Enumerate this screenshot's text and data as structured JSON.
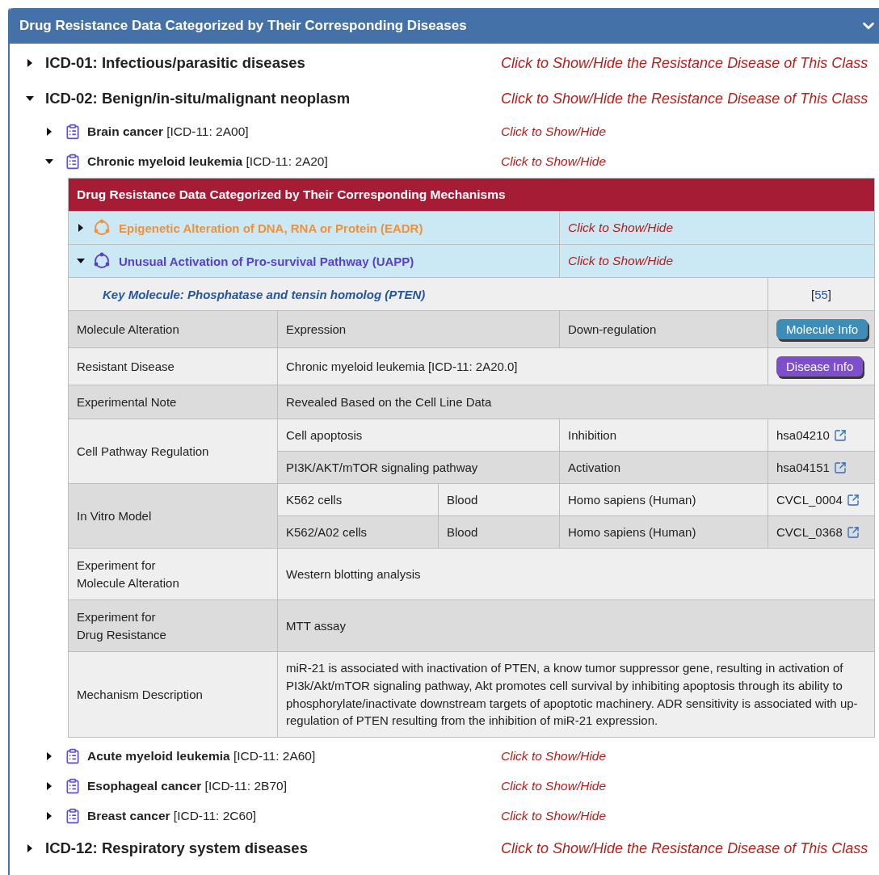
{
  "panel": {
    "title": "Drug Resistance Data Categorized by Their Corresponding Diseases",
    "expanded": true
  },
  "classes": [
    {
      "label": "ICD-01: Infectious/parasitic diseases",
      "toggle": "Click to Show/Hide the Resistance Disease of This Class",
      "expanded": false
    },
    {
      "label": "ICD-02: Benign/in-situ/malignant neoplasm",
      "toggle": "Click to Show/Hide the Resistance Disease of This Class",
      "expanded": true,
      "diseases": [
        {
          "name": "Brain cancer",
          "code": "[ICD-11: 2A00]",
          "toggle": "Click to Show/Hide",
          "expanded": false
        },
        {
          "name": "Chronic myeloid leukemia",
          "code": "[ICD-11: 2A20]",
          "toggle": "Click to Show/Hide",
          "expanded": true,
          "mechanisms": {
            "title": "Drug Resistance Data Categorized by Their Corresponding Mechanisms",
            "items": [
              {
                "name": "Epigenetic Alteration of DNA, RNA or Protein (EADR)",
                "toggle": "Click to Show/Hide",
                "expanded": false,
                "color": "#f0913a"
              },
              {
                "name": "Unusual Activation of Pro-survival Pathway (UAPP)",
                "toggle": "Click to Show/Hide",
                "expanded": true,
                "color": "#5b3fc8",
                "details": {
                  "key_molecule": "Key Molecule: Phosphatase and tensin homolog (PTEN)",
                  "reference": {
                    "before": "[",
                    "link": "55",
                    "after": "]"
                  },
                  "rows": [
                    {
                      "kind": "alteration",
                      "label": "Molecule Alteration",
                      "value": "Expression",
                      "direction": "Down-regulation",
                      "button": "Molecule Info"
                    },
                    {
                      "kind": "disease",
                      "label": "Resistant Disease",
                      "value": "Chronic myeloid leukemia [ICD-11: 2A20.0]",
                      "button": "Disease Info"
                    },
                    {
                      "kind": "text",
                      "label": "Experimental Note",
                      "value": "Revealed Based on the Cell Line Data"
                    },
                    {
                      "kind": "pathway",
                      "label": "Cell Pathway Regulation",
                      "entries": [
                        {
                          "pathway": "Cell apoptosis",
                          "effect": "Inhibition",
                          "id": "hsa04210"
                        },
                        {
                          "pathway": "PI3K/AKT/mTOR signaling pathway",
                          "effect": "Activation",
                          "id": "hsa04151"
                        }
                      ]
                    },
                    {
                      "kind": "model",
                      "label": "In Vitro Model",
                      "entries": [
                        {
                          "cell": "K562 cells",
                          "tissue": "Blood",
                          "species": "Homo sapiens (Human)",
                          "id": "CVCL_0004"
                        },
                        {
                          "cell": "K562/A02 cells",
                          "tissue": "Blood",
                          "species": "Homo sapiens (Human)",
                          "id": "CVCL_0368"
                        }
                      ]
                    },
                    {
                      "kind": "text",
                      "label": "Experiment for\nMolecule Alteration",
                      "value": "Western blotting analysis"
                    },
                    {
                      "kind": "text",
                      "label": "Experiment for\nDrug Resistance",
                      "value": "MTT assay"
                    },
                    {
                      "kind": "text",
                      "label": "Mechanism Description",
                      "value": "miR-21 is associated with inactivation of PTEN, a know tumor suppressor gene, resulting in activation of PI3k/Akt/mTOR signaling pathway, Akt promotes cell survival by inhibiting apoptosis through its ability to phosphorylate/inactivate downstream targets of apoptotic machinery. ADR sensitivity is associated with up-regulation of PTEN resulting from the inhibition of miR-21 expression."
                    }
                  ]
                }
              }
            ]
          }
        },
        {
          "name": "Acute myeloid leukemia",
          "code": "[ICD-11: 2A60]",
          "toggle": "Click to Show/Hide",
          "expanded": false
        },
        {
          "name": "Esophageal cancer",
          "code": "[ICD-11: 2B70]",
          "toggle": "Click to Show/Hide",
          "expanded": false
        },
        {
          "name": "Breast cancer",
          "code": "[ICD-11: 2C60]",
          "toggle": "Click to Show/Hide",
          "expanded": false
        }
      ]
    },
    {
      "label": "ICD-12: Respiratory system diseases",
      "toggle": "Click to Show/Hide the Resistance Disease of This Class",
      "expanded": false
    }
  ]
}
